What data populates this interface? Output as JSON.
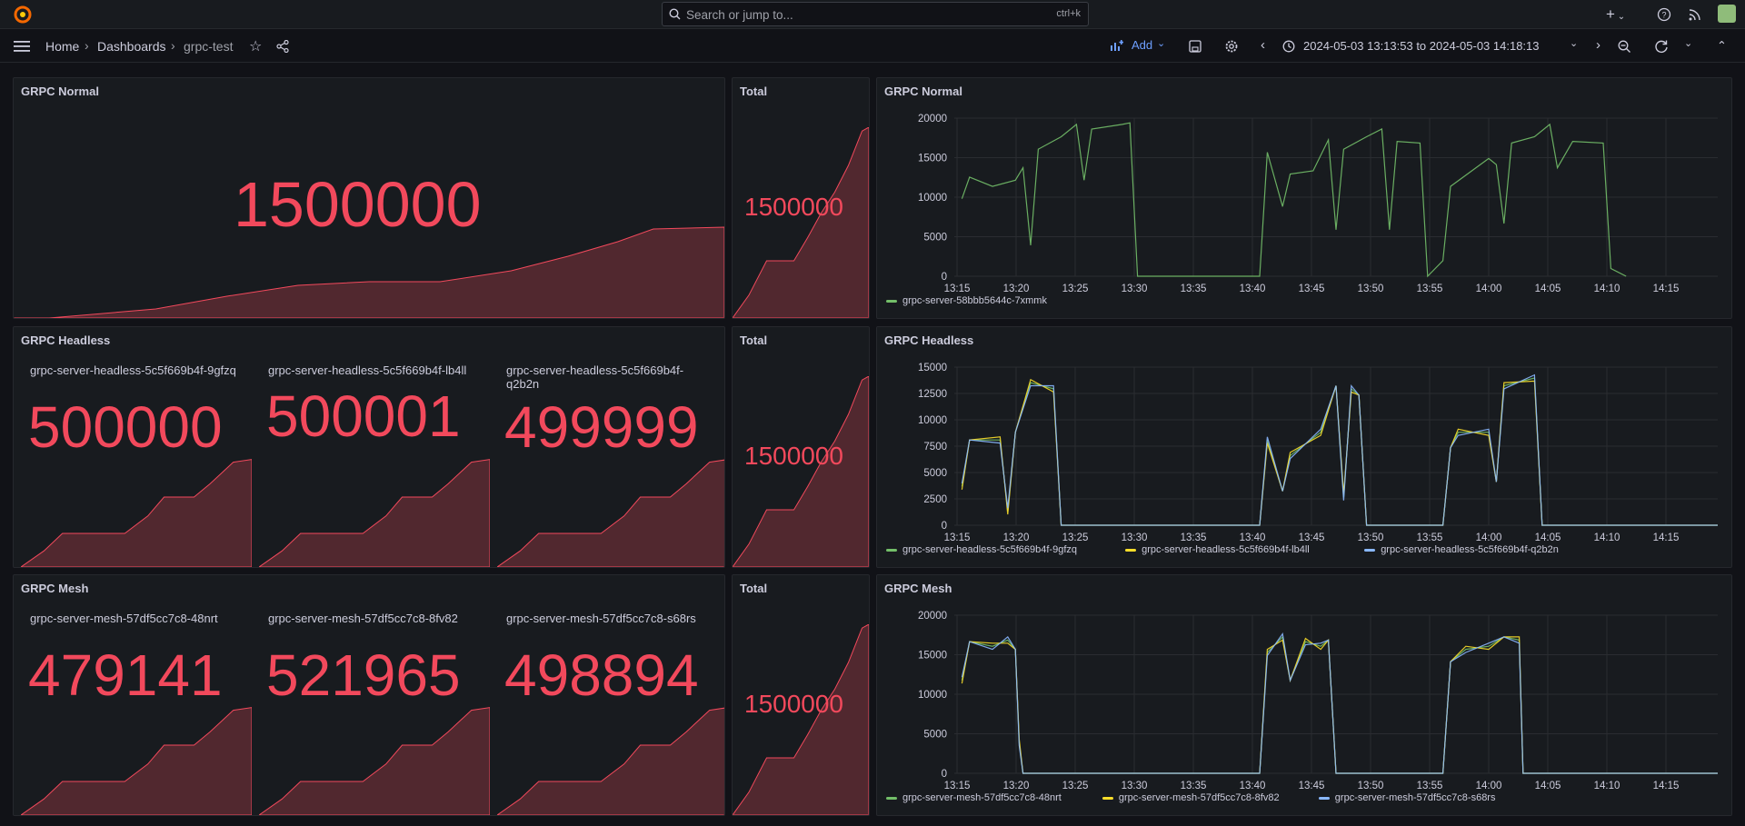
{
  "topbar": {
    "search_placeholder": "Search or jump to...",
    "search_shortcut": "ctrl+k",
    "plus_label": "+"
  },
  "breadcrumb": {
    "home": "Home",
    "dashboards": "Dashboards",
    "current": "grpc-test"
  },
  "toolbar": {
    "add_label": "Add",
    "time_range": "2024-05-03 13:13:53 to 2024-05-03 14:18:13"
  },
  "colors": {
    "stat_red": "#f2495c",
    "green": "#73bf69",
    "yellow": "#fade2a",
    "blue": "#8ab8ff"
  },
  "rows": [
    {
      "title": "GRPC Normal",
      "stats": [
        {
          "label": "",
          "value": "1500000"
        }
      ],
      "total": {
        "title": "Total",
        "value": "1500000"
      },
      "timeseries": {
        "title": "GRPC Normal",
        "y_ticks": [
          "20000",
          "15000",
          "10000",
          "5000",
          "0"
        ],
        "x_ticks": [
          "13:15",
          "13:20",
          "13:25",
          "13:30",
          "13:35",
          "13:40",
          "13:45",
          "13:50",
          "13:55",
          "14:00",
          "14:05",
          "14:10",
          "14:15"
        ],
        "legend": [
          "grpc-server-58bbb5644c-7xmmk"
        ]
      }
    },
    {
      "title": "GRPC Headless",
      "stats": [
        {
          "label": "grpc-server-headless-5c5f669b4f-9gfzq",
          "value": "500000"
        },
        {
          "label": "grpc-server-headless-5c5f669b4f-lb4ll",
          "value": "500001"
        },
        {
          "label": "grpc-server-headless-5c5f669b4f-q2b2n",
          "value": "499999"
        }
      ],
      "total": {
        "title": "Total",
        "value": "1500000"
      },
      "timeseries": {
        "title": "GRPC Headless",
        "y_ticks": [
          "15000",
          "12500",
          "10000",
          "7500",
          "5000",
          "2500",
          "0"
        ],
        "x_ticks": [
          "13:15",
          "13:20",
          "13:25",
          "13:30",
          "13:35",
          "13:40",
          "13:45",
          "13:50",
          "13:55",
          "14:00",
          "14:05",
          "14:10",
          "14:15"
        ],
        "legend": [
          "grpc-server-headless-5c5f669b4f-9gfzq",
          "grpc-server-headless-5c5f669b4f-lb4ll",
          "grpc-server-headless-5c5f669b4f-q2b2n"
        ]
      }
    },
    {
      "title": "GRPC Mesh",
      "stats": [
        {
          "label": "grpc-server-mesh-57df5cc7c8-48nrt",
          "value": "479141"
        },
        {
          "label": "grpc-server-mesh-57df5cc7c8-8fv82",
          "value": "521965"
        },
        {
          "label": "grpc-server-mesh-57df5cc7c8-s68rs",
          "value": "498894"
        }
      ],
      "total": {
        "title": "Total",
        "value": "1500000"
      },
      "timeseries": {
        "title": "GRPC Mesh",
        "y_ticks": [
          "20000",
          "15000",
          "10000",
          "5000",
          "0"
        ],
        "x_ticks": [
          "13:15",
          "13:20",
          "13:25",
          "13:30",
          "13:35",
          "13:40",
          "13:45",
          "13:50",
          "13:55",
          "14:00",
          "14:05",
          "14:10",
          "14:15"
        ],
        "legend": [
          "grpc-server-mesh-57df5cc7c8-48nrt",
          "grpc-server-mesh-57df5cc7c8-8fv82",
          "grpc-server-mesh-57df5cc7c8-s68rs"
        ]
      }
    }
  ]
}
